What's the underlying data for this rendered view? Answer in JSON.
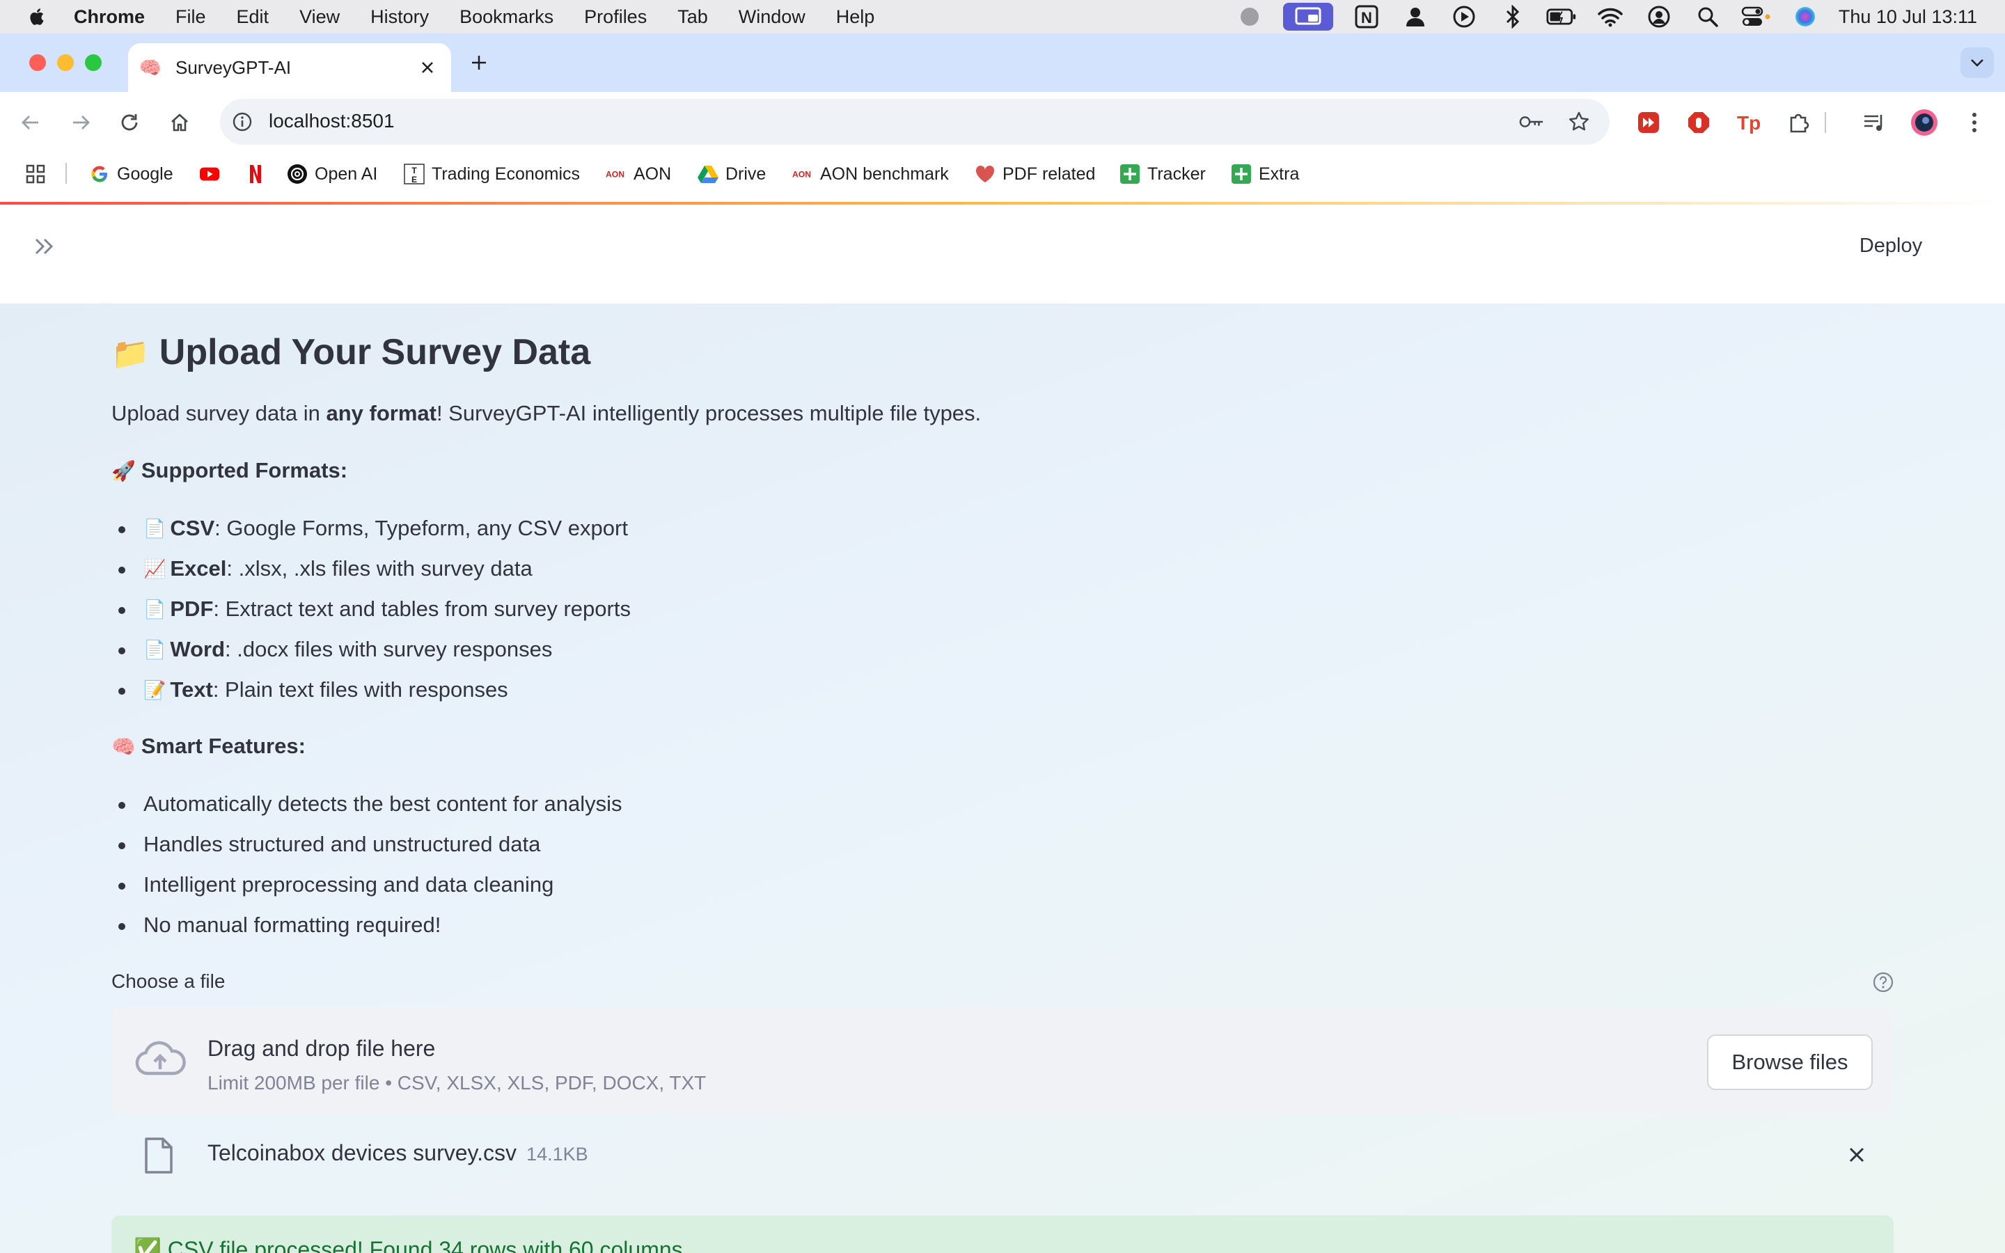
{
  "menubar": {
    "app": "Chrome",
    "items": [
      "File",
      "Edit",
      "View",
      "History",
      "Bookmarks",
      "Profiles",
      "Tab",
      "Window",
      "Help"
    ],
    "clock": "Thu 10 Jul  13:11"
  },
  "browser": {
    "tab_title": "SurveyGPT-AI",
    "tab_favicon": "🧠",
    "url": "localhost:8501"
  },
  "bookmarks": [
    {
      "label": "Google",
      "icon": "google-icon"
    },
    {
      "label": "",
      "icon": "youtube-icon"
    },
    {
      "label": "",
      "icon": "netflix-icon"
    },
    {
      "label": "Open AI",
      "icon": "openai-icon"
    },
    {
      "label": "Trading Economics",
      "icon": "trading-economics-icon"
    },
    {
      "label": "AON",
      "icon": "aon-icon"
    },
    {
      "label": "Drive",
      "icon": "drive-icon"
    },
    {
      "label": "AON benchmark",
      "icon": "aon-icon"
    },
    {
      "label": "PDF related",
      "icon": "heart-icon"
    },
    {
      "label": "Tracker",
      "icon": "sheets-icon"
    },
    {
      "label": "Extra",
      "icon": "sheets-icon"
    }
  ],
  "header": {
    "deploy_label": "Deploy"
  },
  "page": {
    "title_emoji": "📁",
    "title": "Upload Your Survey Data",
    "intro_prefix": "Upload survey data in ",
    "intro_bold": "any format",
    "intro_suffix": "! SurveyGPT-AI intelligently processes multiple file types.",
    "formats_emoji": "🚀",
    "formats_heading": "Supported Formats:",
    "formats": [
      {
        "emoji": "📄",
        "name": "CSV",
        "desc": ": Google Forms, Typeform, any CSV export"
      },
      {
        "emoji": "📈",
        "name": "Excel",
        "desc": ": .xlsx, .xls files with survey data"
      },
      {
        "emoji": "📄",
        "name": "PDF",
        "desc": ": Extract text and tables from survey reports"
      },
      {
        "emoji": "📄",
        "name": "Word",
        "desc": ": .docx files with survey responses"
      },
      {
        "emoji": "📝",
        "name": "Text",
        "desc": ": Plain text files with responses"
      }
    ],
    "features_emoji": "🧠",
    "features_heading": "Smart Features:",
    "features": [
      "Automatically detects the best content for analysis",
      "Handles structured and unstructured data",
      "Intelligent preprocessing and data cleaning",
      "No manual formatting required!"
    ]
  },
  "uploader": {
    "label": "Choose a file",
    "drop_title": "Drag and drop file here",
    "limit": "Limit 200MB per file • CSV, XLSX, XLS, PDF, DOCX, TXT",
    "browse_label": "Browse files",
    "file_name": "Telcoinabox devices survey.csv",
    "file_size": "14.1KB"
  },
  "status": {
    "success_message": "✅ CSV file processed! Found 34 rows with 60 columns"
  },
  "colors": {
    "accent": "#ff4b4b",
    "success_bg": "#d9efe0",
    "success_text": "#177233",
    "tabstrip": "#d3e3fd"
  }
}
